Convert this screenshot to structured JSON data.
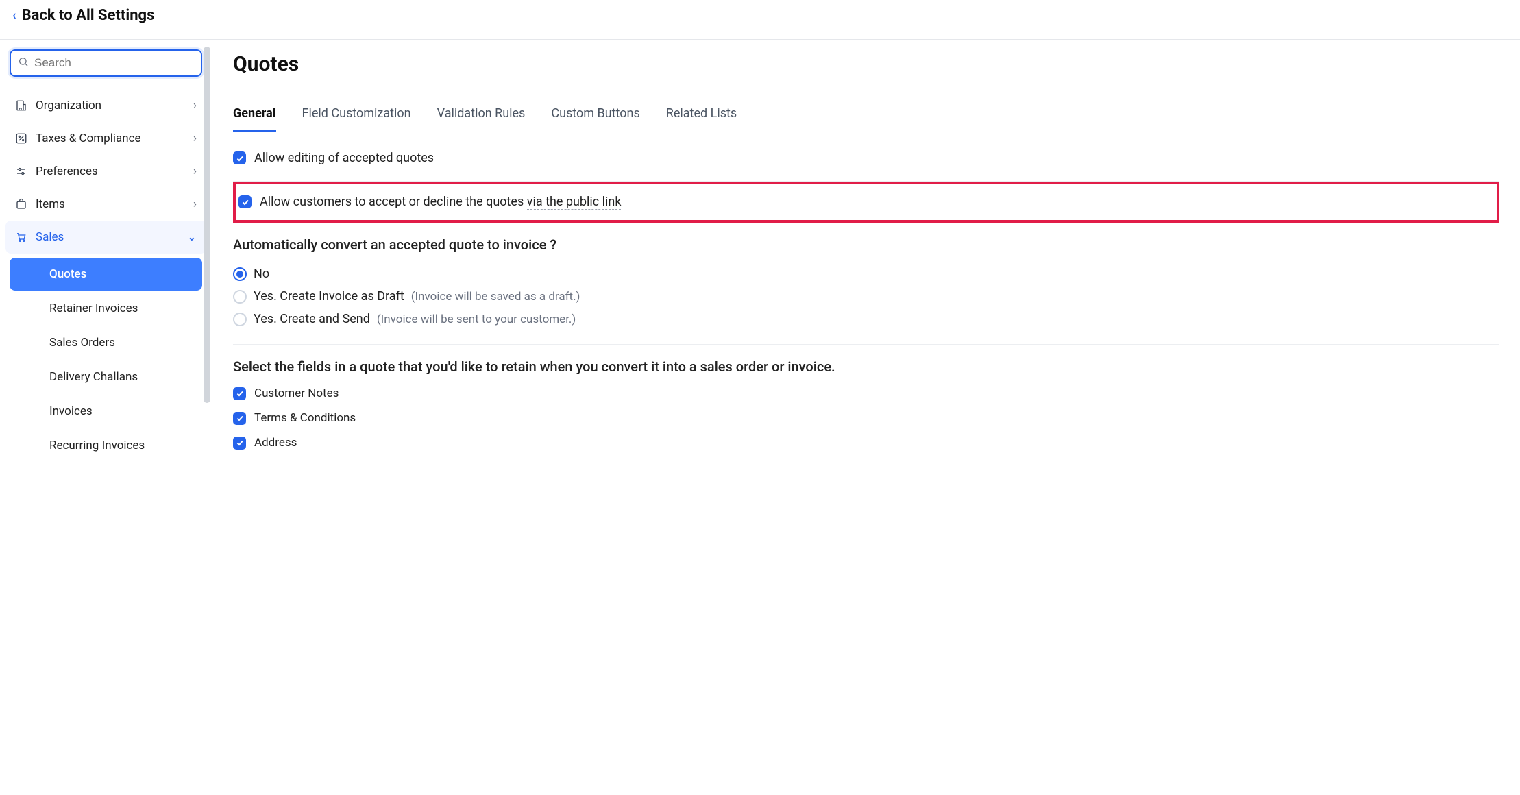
{
  "header": {
    "back_label": "Back to All Settings"
  },
  "sidebar": {
    "search_placeholder": "Search",
    "groups": [
      {
        "key": "organization",
        "label": "Organization",
        "expanded": false,
        "active": false
      },
      {
        "key": "taxes",
        "label": "Taxes & Compliance",
        "expanded": false,
        "active": false
      },
      {
        "key": "preferences",
        "label": "Preferences",
        "expanded": false,
        "active": false
      },
      {
        "key": "items",
        "label": "Items",
        "expanded": false,
        "active": false
      },
      {
        "key": "sales",
        "label": "Sales",
        "expanded": true,
        "active": true
      }
    ],
    "sales_children": [
      {
        "label": "Quotes",
        "selected": true
      },
      {
        "label": "Retainer Invoices",
        "selected": false
      },
      {
        "label": "Sales Orders",
        "selected": false
      },
      {
        "label": "Delivery Challans",
        "selected": false
      },
      {
        "label": "Invoices",
        "selected": false
      },
      {
        "label": "Recurring Invoices",
        "selected": false
      }
    ]
  },
  "page": {
    "title": "Quotes",
    "tabs": [
      {
        "label": "General",
        "active": true
      },
      {
        "label": "Field Customization",
        "active": false
      },
      {
        "label": "Validation Rules",
        "active": false
      },
      {
        "label": "Custom Buttons",
        "active": false
      },
      {
        "label": "Related Lists",
        "active": false
      }
    ],
    "checkbox1_label": "Allow editing of accepted quotes",
    "checkbox2_prefix": "Allow customers to accept or decline the quotes ",
    "checkbox2_link": "via the public link",
    "auto_convert": {
      "heading": "Automatically convert an accepted quote to invoice ?",
      "options": [
        {
          "label": "No",
          "hint": "",
          "checked": true
        },
        {
          "label": "Yes. Create Invoice as Draft ",
          "hint": "(Invoice will be saved as a draft.)",
          "checked": false
        },
        {
          "label": "Yes. Create and Send ",
          "hint": "(Invoice will be sent to your customer.)",
          "checked": false
        }
      ]
    },
    "retain": {
      "heading": "Select the fields in a quote that you'd like to retain when you convert it into a sales order or invoice.",
      "fields": [
        {
          "label": "Customer Notes"
        },
        {
          "label": "Terms & Conditions"
        },
        {
          "label": "Address"
        }
      ]
    }
  }
}
